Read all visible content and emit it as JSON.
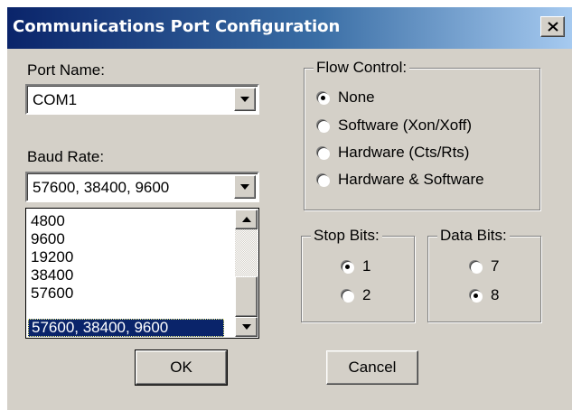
{
  "window": {
    "title": "Communications Port Configuration",
    "close_label": "close"
  },
  "port_name": {
    "label": "Port Name:",
    "value": "COM1"
  },
  "baud_rate": {
    "label": "Baud Rate:",
    "value": "57600, 38400, 9600",
    "options": [
      "4800",
      "9600",
      "19200",
      "38400",
      "57600",
      "57600, 38400, 9600"
    ],
    "selected_index": 5
  },
  "flow_control": {
    "label": "Flow Control:",
    "options": [
      {
        "label": "None",
        "checked": true
      },
      {
        "label": "Software (Xon/Xoff)",
        "checked": false
      },
      {
        "label": "Hardware (Cts/Rts)",
        "checked": false
      },
      {
        "label": "Hardware & Software",
        "checked": false
      }
    ]
  },
  "stop_bits": {
    "label": "Stop Bits:",
    "options": [
      {
        "label": "1",
        "checked": true
      },
      {
        "label": "2",
        "checked": false
      }
    ]
  },
  "data_bits": {
    "label": "Data Bits:",
    "options": [
      {
        "label": "7",
        "checked": false
      },
      {
        "label": "8",
        "checked": true
      }
    ]
  },
  "buttons": {
    "ok": "OK",
    "cancel": "Cancel"
  },
  "colors": {
    "dialog_face": "#d4d0c8",
    "title_start": "#0a246a",
    "title_end": "#a6caf0",
    "selection": "#0a246a"
  }
}
